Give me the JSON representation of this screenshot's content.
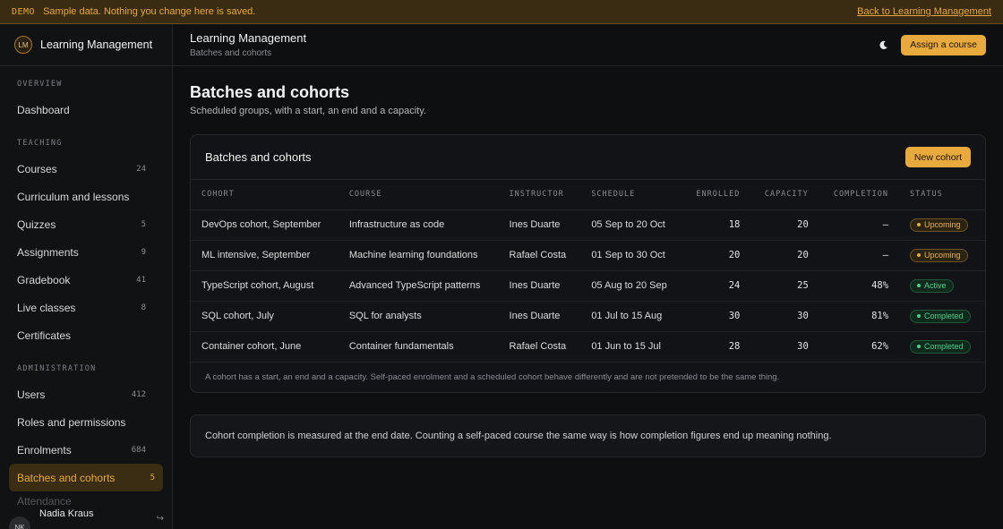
{
  "demo_bar": {
    "tag": "DEMO",
    "text": "Sample data. Nothing you change here is saved.",
    "link": "Back to Learning Management"
  },
  "sidebar": {
    "brand_mark": "LM",
    "brand_name": "Learning Management",
    "sections": [
      {
        "label": "OVERVIEW",
        "items": [
          {
            "label": "Dashboard",
            "count": ""
          }
        ]
      },
      {
        "label": "TEACHING",
        "items": [
          {
            "label": "Courses",
            "count": "24"
          },
          {
            "label": "Curriculum and lessons",
            "count": ""
          },
          {
            "label": "Quizzes",
            "count": "5"
          },
          {
            "label": "Assignments",
            "count": "9"
          },
          {
            "label": "Gradebook",
            "count": "41"
          },
          {
            "label": "Live classes",
            "count": "8"
          },
          {
            "label": "Certificates",
            "count": ""
          }
        ]
      },
      {
        "label": "ADMINISTRATION",
        "items": [
          {
            "label": "Users",
            "count": "412"
          },
          {
            "label": "Roles and permissions",
            "count": ""
          },
          {
            "label": "Enrolments",
            "count": "684"
          },
          {
            "label": "Batches and cohorts",
            "count": "5",
            "active": true
          },
          {
            "label": "Attendance",
            "count": ""
          }
        ]
      }
    ],
    "user": {
      "initials": "NK",
      "name": "Nadia Kraus",
      "action_icon": "logout-icon"
    }
  },
  "topbar": {
    "title": "Learning Management",
    "subtitle": "Batches and cohorts",
    "theme_icon": "moon-icon",
    "primary_button": "Assign a course"
  },
  "page": {
    "title": "Batches and cohorts",
    "subtitle": "Scheduled groups, with a start, an end and a capacity."
  },
  "cohorts_card": {
    "title": "Batches and cohorts",
    "button": "New cohort",
    "columns": [
      "COHORT",
      "COURSE",
      "INSTRUCTOR",
      "SCHEDULE",
      "ENROLLED",
      "CAPACITY",
      "COMPLETION",
      "STATUS"
    ],
    "rows": [
      {
        "cohort": "DevOps cohort, September",
        "course": "Infrastructure as code",
        "instructor": "Ines Duarte",
        "schedule": "05 Sep to 20 Oct",
        "enrolled": "18",
        "capacity": "20",
        "completion": "—",
        "status": "Upcoming",
        "status_kind": "upcoming"
      },
      {
        "cohort": "ML intensive, September",
        "course": "Machine learning foundations",
        "instructor": "Rafael Costa",
        "schedule": "01 Sep to 30 Oct",
        "enrolled": "20",
        "capacity": "20",
        "completion": "—",
        "status": "Upcoming",
        "status_kind": "upcoming"
      },
      {
        "cohort": "TypeScript cohort, August",
        "course": "Advanced TypeScript patterns",
        "instructor": "Ines Duarte",
        "schedule": "05 Aug to 20 Sep",
        "enrolled": "24",
        "capacity": "25",
        "completion": "48%",
        "status": "Active",
        "status_kind": "active"
      },
      {
        "cohort": "SQL cohort, July",
        "course": "SQL for analysts",
        "instructor": "Ines Duarte",
        "schedule": "01 Jul to 15 Aug",
        "enrolled": "30",
        "capacity": "30",
        "completion": "81%",
        "status": "Completed",
        "status_kind": "completed"
      },
      {
        "cohort": "Container cohort, June",
        "course": "Container fundamentals",
        "instructor": "Rafael Costa",
        "schedule": "01 Jun to 15 Jul",
        "enrolled": "28",
        "capacity": "30",
        "completion": "62%",
        "status": "Completed",
        "status_kind": "completed"
      }
    ],
    "footnote": "A cohort has a start, an end and a capacity. Self-paced enrolment and a scheduled cohort behave differently and are not pretended to be the same thing."
  },
  "note": "Cohort completion is measured at the end date. Counting a self-paced course the same way is how completion figures end up meaning nothing.",
  "colors": {
    "accent": "#e8a93d",
    "success": "#4fd08a",
    "background": "#0e0f11"
  }
}
